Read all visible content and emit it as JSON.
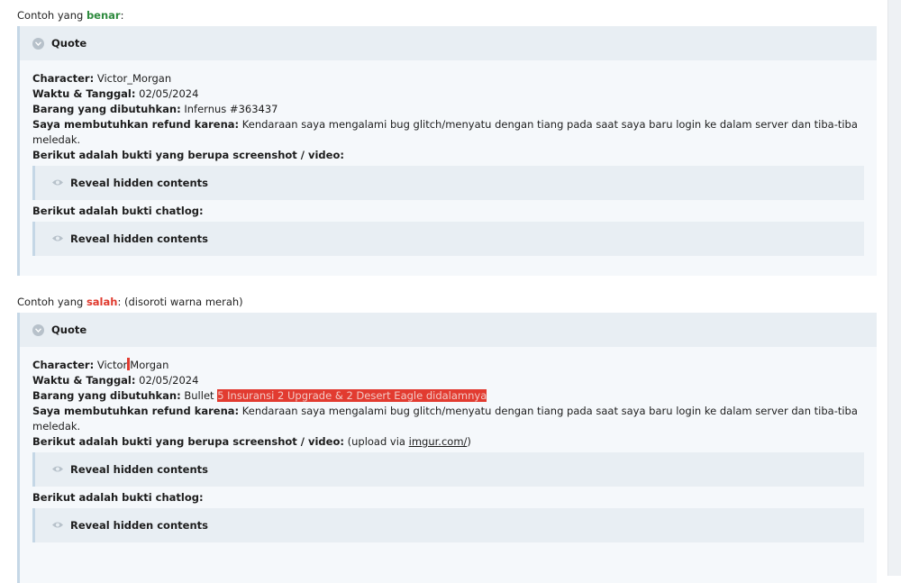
{
  "example_good": {
    "intro_prefix": "Contoh yang ",
    "intro_word": "benar",
    "intro_suffix": ":",
    "quote_title": "Quote",
    "character_label": "Character:",
    "character_value": "Victor_Morgan",
    "date_label": "Waktu & Tanggal:",
    "date_value": "02/05/2024",
    "item_label": "Barang yang dibutuhkan:",
    "item_value": "Infernus #363437",
    "reason_label": "Saya membutuhkan refund karena:",
    "reason_value": "Kendaraan saya mengalami bug glitch/menyatu dengan tiang pada saat saya baru login ke dalam server dan tiba-tiba meledak.",
    "proof_label": "Berikut adalah bukti yang berupa screenshot / video:",
    "spoiler1": "Reveal hidden contents",
    "chatlog_label": "Berikut adalah bukti chatlog:",
    "spoiler2": "Reveal hidden contents"
  },
  "example_bad": {
    "intro_prefix": "Contoh yang ",
    "intro_word": "salah",
    "intro_suffix": ": (disoroti warna merah)",
    "quote_title": "Quote",
    "character_label": "Character:",
    "character_value_a": "Victor",
    "character_value_b": "Morgan",
    "date_label": "Waktu & Tanggal:",
    "date_value": "02/05/2024",
    "item_label": "Barang yang dibutuhkan:",
    "item_value": "Bullet ",
    "item_highlight": "5 Insuransi 2 Upgrade & 2 Desert Eagle didalamnya",
    "reason_label": "Saya membutuhkan refund karena:",
    "reason_value": "Kendaraan saya mengalami bug glitch/menyatu dengan tiang pada saat saya baru login ke dalam server dan tiba-tiba meledak.",
    "proof_label": "Berikut adalah bukti yang berupa screenshot / video:",
    "proof_note_prefix": " (upload via ",
    "proof_link": "imgur.com/",
    "proof_note_suffix": ")",
    "spoiler1": "Reveal hidden contents",
    "chatlog_label": "Berikut adalah bukti chatlog:",
    "spoiler2": "Reveal hidden contents"
  },
  "colors": {
    "good": "#2e8b3e",
    "bad": "#e03a2e",
    "highlight": "#e23b30"
  },
  "icons": {
    "quote": "chevron-down-icon",
    "spoiler": "eye-icon"
  }
}
